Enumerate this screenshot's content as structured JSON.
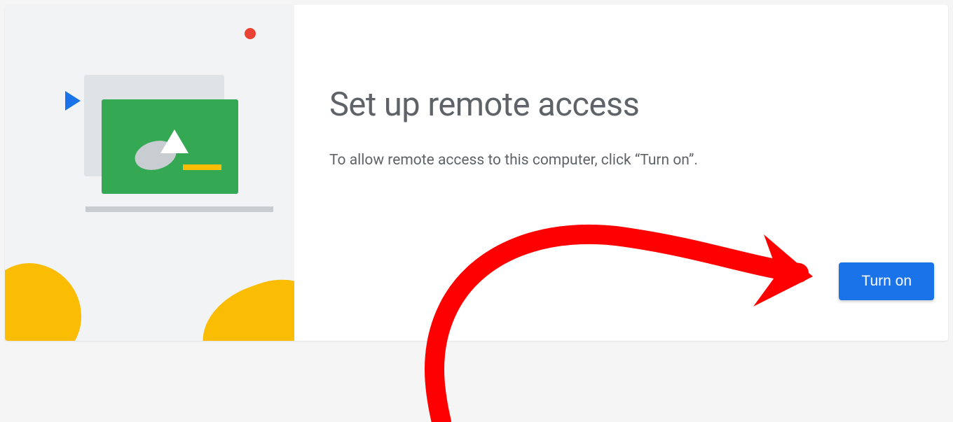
{
  "card": {
    "title": "Set up remote access",
    "description": "To allow remote access to this computer, click “Turn on”.",
    "button_label": "Turn on"
  },
  "colors": {
    "primary": "#1a73e8",
    "green": "#34a853",
    "yellow": "#fbbc04",
    "red": "#ea4335",
    "text": "#5f6368",
    "panel_bg": "#f1f3f4"
  },
  "annotation": {
    "type": "hand-drawn-arrow",
    "color": "#ff0000",
    "points_to": "turn-on-button"
  }
}
